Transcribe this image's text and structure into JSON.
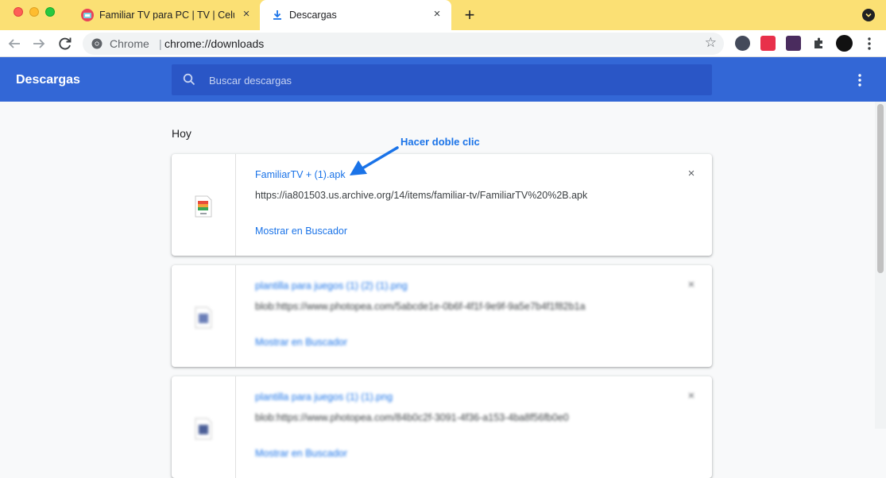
{
  "window": {
    "tabs": [
      {
        "title": "Familiar TV para PC | TV | Celul",
        "active": false,
        "favicon": "tv-favicon-icon"
      },
      {
        "title": "Descargas",
        "active": true,
        "favicon": "download-icon"
      }
    ],
    "new_tab_label": "+",
    "close_label": "×"
  },
  "toolbar": {
    "omnibox_scheme": "Chrome",
    "omnibox_separator": "|",
    "omnibox_url": "chrome://downloads",
    "star_label": "☆"
  },
  "downloads": {
    "title": "Descargas",
    "search_placeholder": "Buscar descargas",
    "section_label": "Hoy",
    "items": [
      {
        "file_name": "FamiliarTV + (1).apk",
        "url": "https://ia801503.us.archive.org/14/items/familiar-tv/FamiliarTV%20%2B.apk",
        "action": "Mostrar en Buscador",
        "remove_label": "×"
      },
      {
        "file_name": "plantilla para juegos (1) (2) (1).png",
        "url": "blob:https://www.photopea.com/5abcde1e-0b6f-4f1f-9e9f-9a5e7b4f1f82b1a",
        "action": "Mostrar en Buscador",
        "remove_label": "×"
      },
      {
        "file_name": "plantilla para juegos (1) (1).png",
        "url": "blob:https://www.photopea.com/84b0c2f-3091-4f36-a153-4ba8f56fb0e0",
        "action": "Mostrar en Buscador",
        "remove_label": "×"
      }
    ]
  },
  "annotation": {
    "text": "Hacer doble clic",
    "color": "#1a73e8"
  },
  "colors": {
    "tabstrip": "#fbe074",
    "header": "#3367d6",
    "search_field": "#2a56c6",
    "link": "#1a73e8"
  }
}
